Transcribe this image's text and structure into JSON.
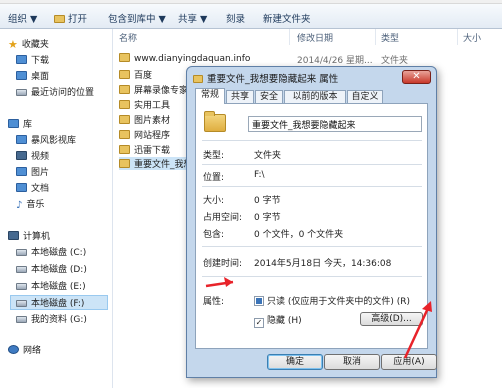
{
  "toolbar": {
    "organize": "组织 ▼",
    "open": "打开",
    "include": "包含到库中 ▼",
    "share": "共享 ▼",
    "burn": "刻录",
    "new_folder": "新建文件夹"
  },
  "nav": {
    "favorites": "收藏夹",
    "downloads": "下载",
    "desktop": "桌面",
    "recent": "最近访问的位置",
    "libraries": "库",
    "storm": "暴风影视库",
    "videos": "视频",
    "pictures": "图片",
    "documents": "文档",
    "music": "音乐",
    "computer": "计算机",
    "drive_c": "本地磁盘 (C:)",
    "drive_d": "本地磁盘 (D:)",
    "drive_e": "本地磁盘 (E:)",
    "drive_f": "本地磁盘 (F:)",
    "drive_g": "我的资料 (G:)",
    "network": "网络"
  },
  "list": {
    "headers": {
      "name": "名称",
      "date": "修改日期",
      "type": "类型",
      "size": "大小"
    },
    "rows": [
      {
        "name": "www.dianyingdaquan.info",
        "date": "2014/4/26 星期...",
        "type": "文件夹"
      },
      {
        "name": "百度",
        "date": "",
        "type": ""
      },
      {
        "name": "屏幕录像专家",
        "date": "",
        "type": ""
      },
      {
        "name": "实用工具",
        "date": "",
        "type": ""
      },
      {
        "name": "图片素材",
        "date": "",
        "type": ""
      },
      {
        "name": "网站程序",
        "date": "",
        "type": ""
      },
      {
        "name": "迅雷下载",
        "date": "",
        "type": ""
      },
      {
        "name": "重要文件_我想",
        "date": "",
        "type": ""
      }
    ]
  },
  "dialog": {
    "title": "重要文件_我想要隐藏起来 属性",
    "close": "✕",
    "tabs": [
      "常规",
      "共享",
      "安全",
      "以前的版本",
      "自定义"
    ],
    "name_value": "重要文件_我想要隐藏起来",
    "labels": {
      "type": "类型:",
      "location": "位置:",
      "size": "大小:",
      "size_on_disk": "占用空间:",
      "contains": "包含:",
      "created": "创建时间:",
      "attributes": "属性:"
    },
    "values": {
      "type": "文件夹",
      "location": "F:\\",
      "size": "0 字节",
      "size_on_disk": "0 字节",
      "contains": "0 个文件，0 个文件夹",
      "created": "2014年5月18日 今天，14:36:08"
    },
    "attr_readonly": "只读 (仅应用于文件夹中的文件) (R)",
    "attr_hidden": "隐藏 (H)",
    "advanced": "高级(D)...",
    "ok": "确定",
    "cancel": "取消",
    "apply": "应用(A)"
  }
}
